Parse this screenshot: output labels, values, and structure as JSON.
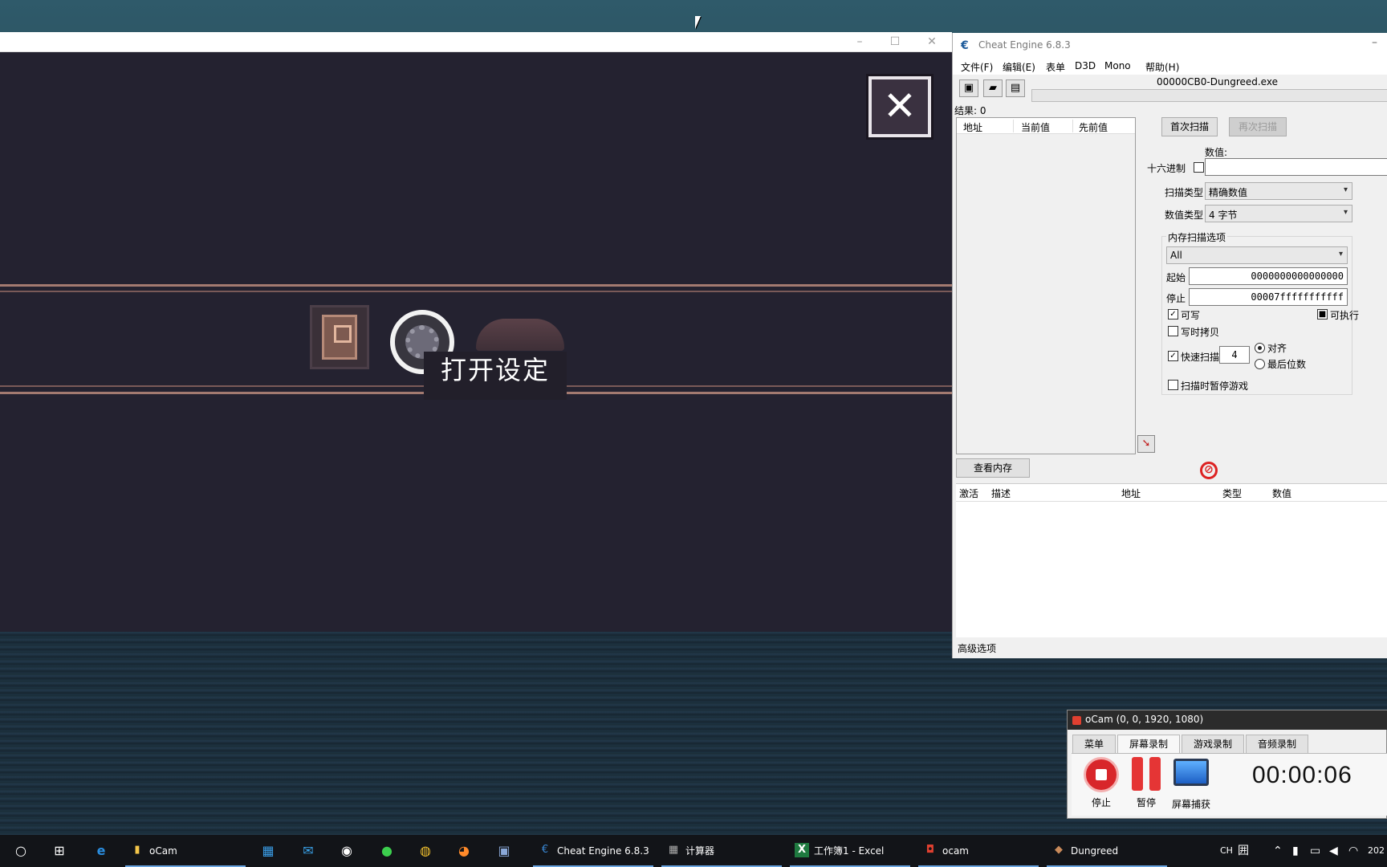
{
  "game": {
    "caption": "打开设定",
    "close_glyph": "✕"
  },
  "cheat_engine": {
    "title": "Cheat Engine 6.8.3",
    "logo_glyph": "€",
    "menu": [
      "文件(F)",
      "编辑(E)",
      "表单",
      "D3D",
      "Mono",
      "帮助(H)"
    ],
    "process": "00000CB0-Dungreed.exe",
    "results_label": "结果: 0",
    "list_columns": [
      "地址",
      "当前值",
      "先前值"
    ],
    "first_scan": "首次扫描",
    "next_scan": "再次扫描",
    "value_label": "数值:",
    "hex_label": "十六进制",
    "scan_type_label": "扫描类型",
    "scan_type_value": "精确数值",
    "value_type_label": "数值类型",
    "value_type_value": "4 字节",
    "mem_options_label": "内存扫描选项",
    "mem_region": "All",
    "start_label": "起始",
    "start_value": "0000000000000000",
    "stop_label": "停止",
    "stop_value": "00007fffffffffff",
    "writable_label": "可写",
    "executable_label": "可执行",
    "copy_on_write_label": "写时拷贝",
    "fast_scan_label": "快速扫描",
    "fast_scan_value": "4",
    "align_label": "对齐",
    "last_digits_label": "最后位数",
    "pause_game_label": "扫描时暂停游戏",
    "view_memory": "查看内存",
    "table_columns": [
      "激活",
      "描述",
      "地址",
      "类型",
      "数值"
    ],
    "advanced_options": "高级选项"
  },
  "ocam": {
    "title": "oCam (0, 0, 1920, 1080)",
    "tabs": [
      "菜单",
      "屏幕录制",
      "游戏录制",
      "音频录制"
    ],
    "stop_label": "停止",
    "pause_label": "暂停",
    "capture_label": "屏幕捕获",
    "timer": "00:00:06"
  },
  "taskbar": {
    "apps": [
      "oCam",
      "Cheat Engine 6.8.3",
      "计算器",
      "工作簿1 - Excel",
      "ocam",
      "Dungreed"
    ],
    "tray_lang": "CH",
    "tray_ime": "囲",
    "clock_fragment": "202"
  }
}
